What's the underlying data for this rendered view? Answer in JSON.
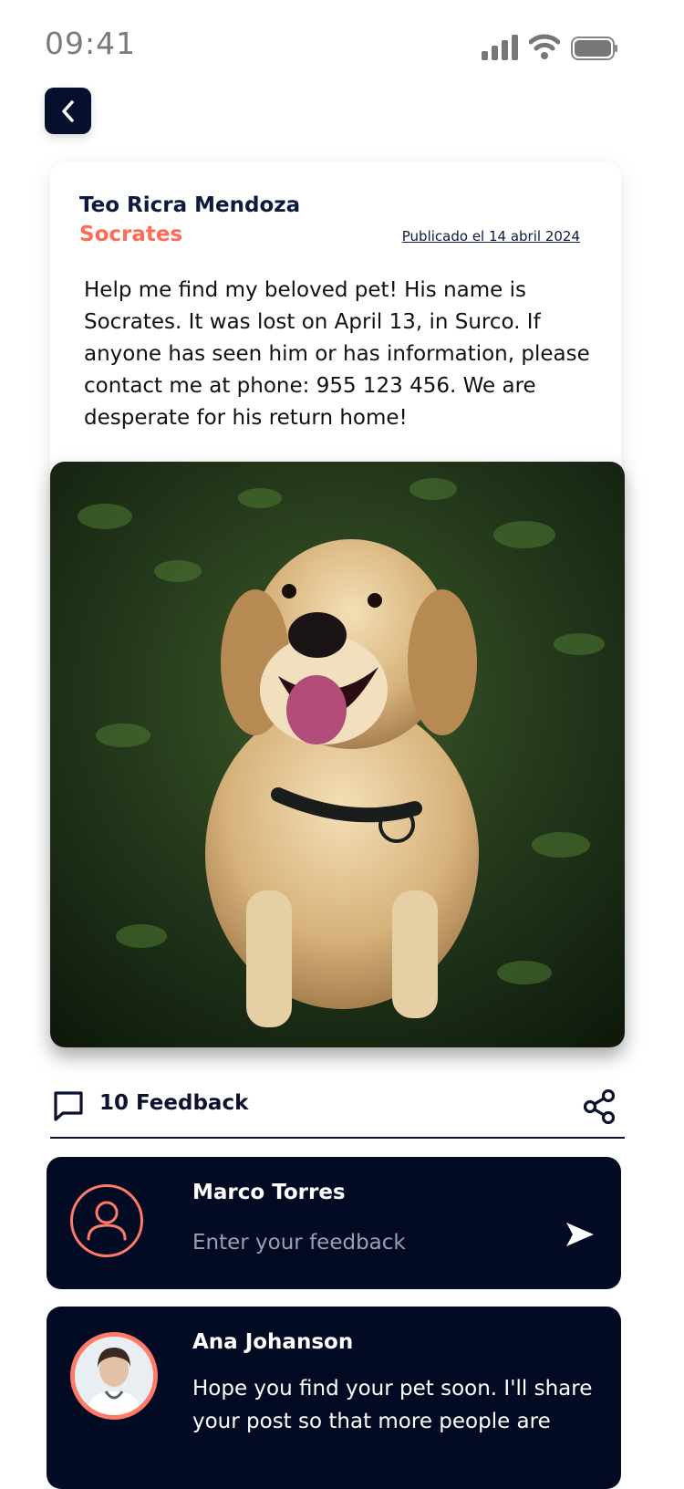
{
  "status_bar": {
    "time": "09:41"
  },
  "post": {
    "author": "Teo Ricra Mendoza",
    "pet_name": "Socrates",
    "published": "Publicado el 14 abril 2024",
    "text": "Help me find my beloved pet! His name is Socrates. It was lost on April 13, in Surco. If anyone has seen him or has information, please contact me at phone: 955 123 456. We are desperate for his return home!"
  },
  "actions": {
    "feedback_count": "10 Feedback"
  },
  "feedback_input": {
    "user_name": "Marco Torres",
    "placeholder": "Enter your feedback"
  },
  "comments": [
    {
      "user_name": "Ana Johanson",
      "text": "Hope you find your pet soon. I'll share your post so that more people are"
    }
  ],
  "colors": {
    "navy": "#030b24",
    "accent": "#ff6b57"
  }
}
